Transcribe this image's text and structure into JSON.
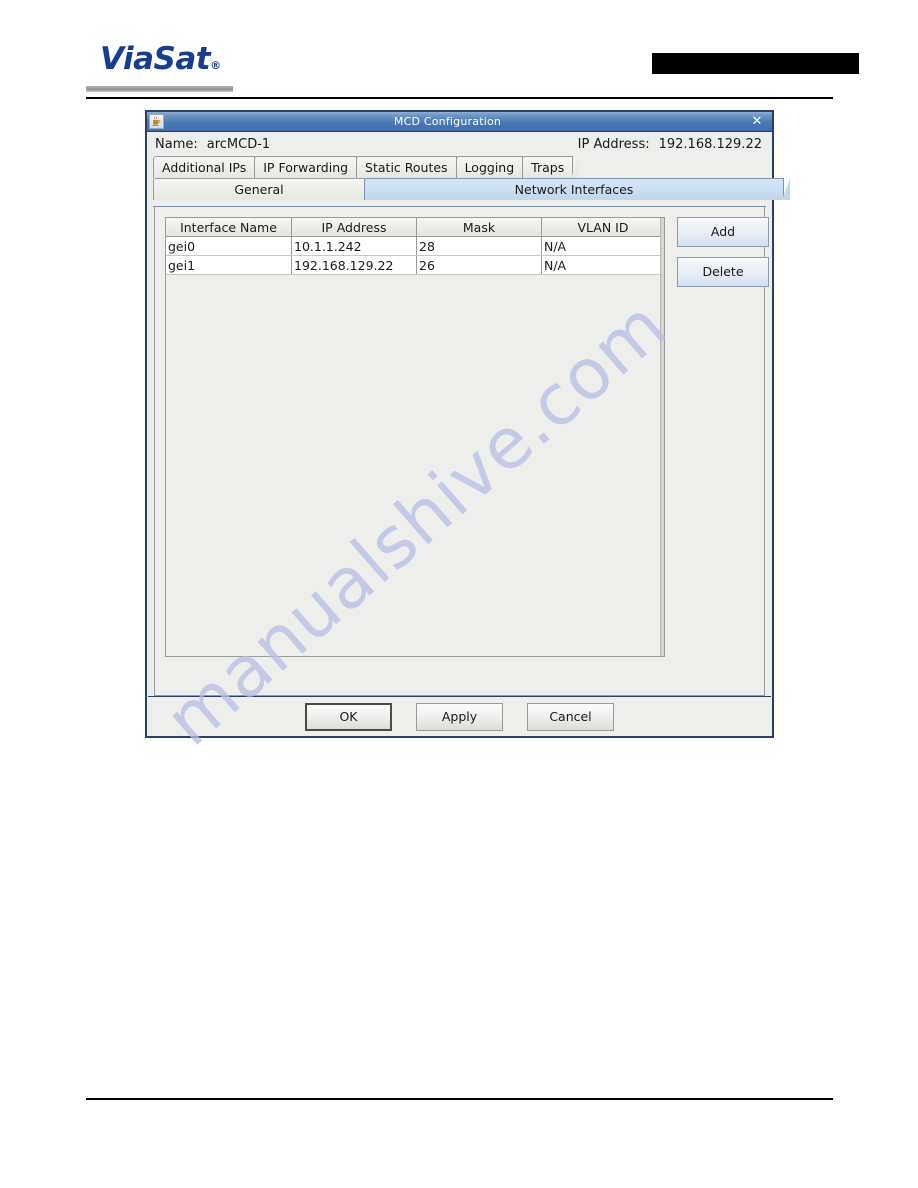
{
  "page": {
    "logo_text": "ViaSat",
    "logo_registered": "®",
    "redaction": ""
  },
  "dialog": {
    "title": "MCD Configuration",
    "title_icon": "java-coffee-cup-icon",
    "close_icon": "✕",
    "name_label": "Name:",
    "name_value": "arcMCD-1",
    "ip_label": "IP Address:",
    "ip_value": "192.168.129.22"
  },
  "tabs": {
    "top_row": [
      {
        "label": "Additional IPs",
        "selected": false
      },
      {
        "label": "IP Forwarding",
        "selected": false
      },
      {
        "label": "Static Routes",
        "selected": false
      },
      {
        "label": "Logging",
        "selected": false
      },
      {
        "label": "Traps",
        "selected": false
      }
    ],
    "bottom_row": [
      {
        "label": "General",
        "selected": false
      },
      {
        "label": "Network Interfaces",
        "selected": true
      }
    ]
  },
  "table": {
    "columns": [
      "Interface Name",
      "IP Address",
      "Mask",
      "VLAN ID"
    ],
    "rows": [
      [
        "gei0",
        "10.1.1.242",
        "28",
        "N/A"
      ],
      [
        "gei1",
        "192.168.129.22",
        "26",
        "N/A"
      ]
    ]
  },
  "side_buttons": {
    "add_label": "Add",
    "delete_label": "Delete"
  },
  "footer_buttons": {
    "ok_label": "OK",
    "apply_label": "Apply",
    "cancel_label": "Cancel"
  },
  "watermark": {
    "text": "manualshive.com"
  },
  "colors": {
    "brand_blue": "#173e8c",
    "titlebar_blue": "#4a79b4",
    "selected_tab": "#c4d8ef",
    "dialog_border": "#2b3f6b",
    "panel_bg": "#eeeeec",
    "watermark": "#b9bfe4"
  }
}
